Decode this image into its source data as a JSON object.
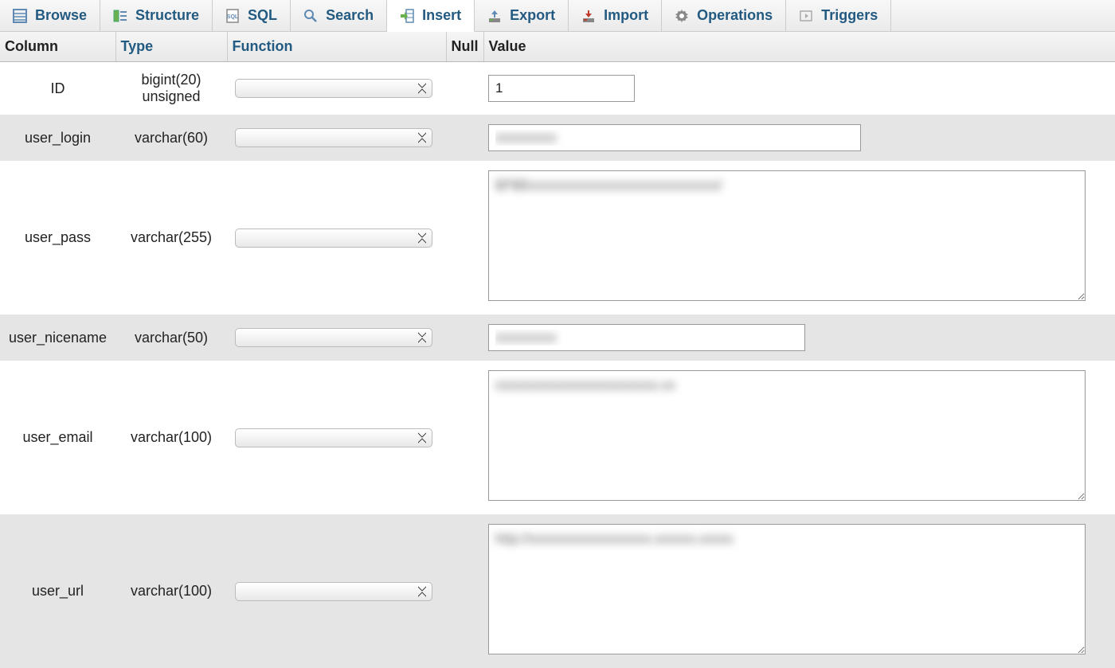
{
  "tabs": [
    {
      "label": "Browse",
      "icon": "browse"
    },
    {
      "label": "Structure",
      "icon": "structure"
    },
    {
      "label": "SQL",
      "icon": "sql"
    },
    {
      "label": "Search",
      "icon": "search"
    },
    {
      "label": "Insert",
      "icon": "insert",
      "active": true
    },
    {
      "label": "Export",
      "icon": "export"
    },
    {
      "label": "Import",
      "icon": "import"
    },
    {
      "label": "Operations",
      "icon": "operations"
    },
    {
      "label": "Triggers",
      "icon": "triggers"
    }
  ],
  "headers": {
    "column": "Column",
    "type": "Type",
    "function": "Function",
    "null": "Null",
    "value": "Value"
  },
  "rows": [
    {
      "column": "ID",
      "type": "bigint(20) unsigned",
      "value": "1",
      "input_kind": "text-short",
      "blurred": false
    },
    {
      "column": "user_login",
      "type": "varchar(60)",
      "value": "xxxxxxxxx",
      "input_kind": "text-med",
      "blurred": true
    },
    {
      "column": "user_pass",
      "type": "varchar(255)",
      "value": "$P$Bxxxxxxxxxxxxxxxxxxxxxxxxxxxx/",
      "input_kind": "textarea",
      "blurred": true
    },
    {
      "column": "user_nicename",
      "type": "varchar(50)",
      "value": "xxxxxxxxx",
      "input_kind": "text-med2",
      "blurred": true
    },
    {
      "column": "user_email",
      "type": "varchar(100)",
      "value": "xxxxxxxxxxxxxxxxxxxxxxxx.xx",
      "input_kind": "textarea",
      "blurred": true
    },
    {
      "column": "user_url",
      "type": "varchar(100)",
      "value": "http://xxxxxxxxxxxxxxxxxx.xxxxxx.xxxxx",
      "input_kind": "textarea",
      "blurred": true
    }
  ]
}
